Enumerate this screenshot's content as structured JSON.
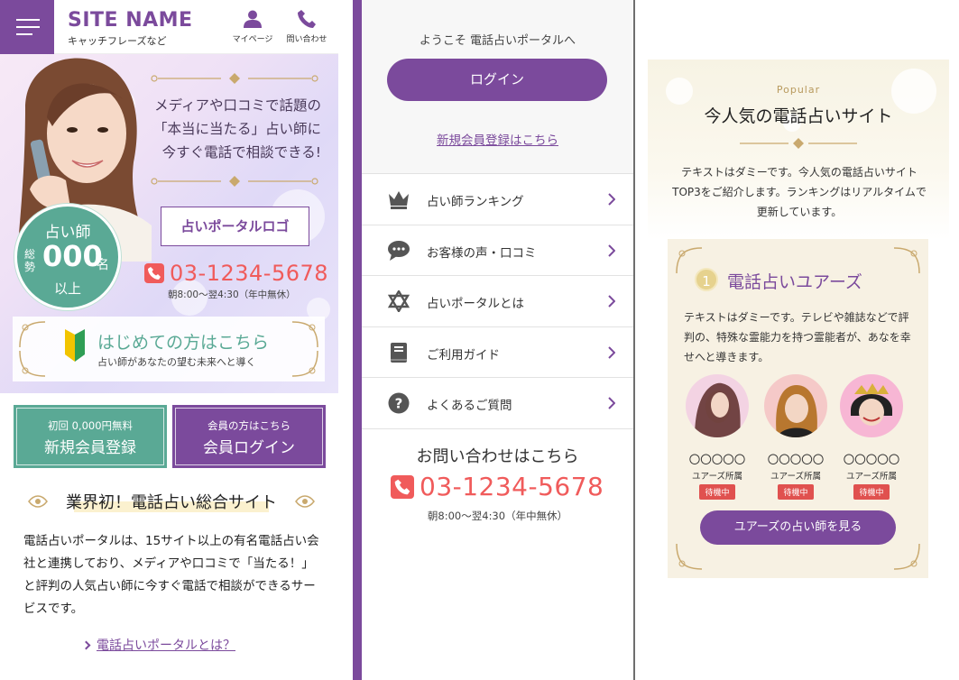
{
  "header": {
    "site_name": "SITE NAME",
    "catchphrase": "キャッチフレーズなど",
    "mypage_label": "マイページ",
    "contact_label": "問い合わせ"
  },
  "hero": {
    "copy_lines": [
      "メディアや口コミで話題の",
      "「本当に当たる」占い師に",
      "今すぐ電話で相談できる!"
    ],
    "badge": {
      "top": "占い師",
      "side": "総勢",
      "count": "000",
      "unit": "名",
      "bottom": "以上"
    },
    "logo_label": "占いポータルロゴ",
    "phone": "03-1234-5678",
    "hours": "朝8:00～翌4:30（年中無休）",
    "first_time": {
      "title": "はじめての方はこちら",
      "subtitle": "占い師があなたの望む未来へと導く"
    }
  },
  "cta": {
    "register_small": "初回 0,000円無料",
    "register_large": "新規会員登録",
    "login_small": "会員の方はこちら",
    "login_large": "会員ログイン"
  },
  "intro": {
    "title": "業界初！電話占い総合サイト",
    "body": "電話占いポータルは、15サイト以上の有名電話占い会社と連携しており、メディアや口コミで「当たる！」と評判の人気占い師に今すぐ電話で相談ができるサービスです。",
    "link": "電話占いポータルとは？"
  },
  "menu_panel": {
    "welcome": "ようこそ 電話占いポータルへ",
    "login_button": "ログイン",
    "register_link": "新規会員登録はこちら",
    "items": [
      {
        "label": "占い師ランキング",
        "icon": "crown-icon"
      },
      {
        "label": "お客様の声・口コミ",
        "icon": "speech-bubble-icon"
      },
      {
        "label": "占いポータルとは",
        "icon": "star-of-david-icon"
      },
      {
        "label": "ご利用ガイド",
        "icon": "book-icon"
      },
      {
        "label": "よくあるご質問",
        "icon": "question-icon"
      }
    ],
    "contact_title": "お問い合わせはこちら",
    "phone": "03-1234-5678",
    "hours": "朝8:00～翌4:30（年中無休）"
  },
  "popular": {
    "eyebrow": "Popular",
    "title": "今人気の電話占いサイト",
    "text": "テキストはダミーです。今人気の電話占いサイトTOP3をご紹介します。ランキングはリアルタイムで更新しています。",
    "card": {
      "rank": "1",
      "name": "電話占いユアーズ",
      "desc": "テキストはダミーです。テレビや雑誌などで評判の、特殊な霊能力を持つ霊能者が、あなを幸せへと導きます。",
      "fortune_tellers": [
        {
          "name": "〇〇〇〇〇",
          "affiliation": "ユアーズ所属",
          "status": "待機中"
        },
        {
          "name": "〇〇〇〇〇",
          "affiliation": "ユアーズ所属",
          "status": "待機中"
        },
        {
          "name": "〇〇〇〇〇",
          "affiliation": "ユアーズ所属",
          "status": "待機中"
        }
      ],
      "button": "ユアーズの占い師を見る"
    }
  },
  "colors": {
    "purple": "#7b4a9c",
    "green": "#5aa995",
    "phone_red": "#f05b5b",
    "gold": "#c9a96e",
    "status_red": "#e0514f"
  }
}
